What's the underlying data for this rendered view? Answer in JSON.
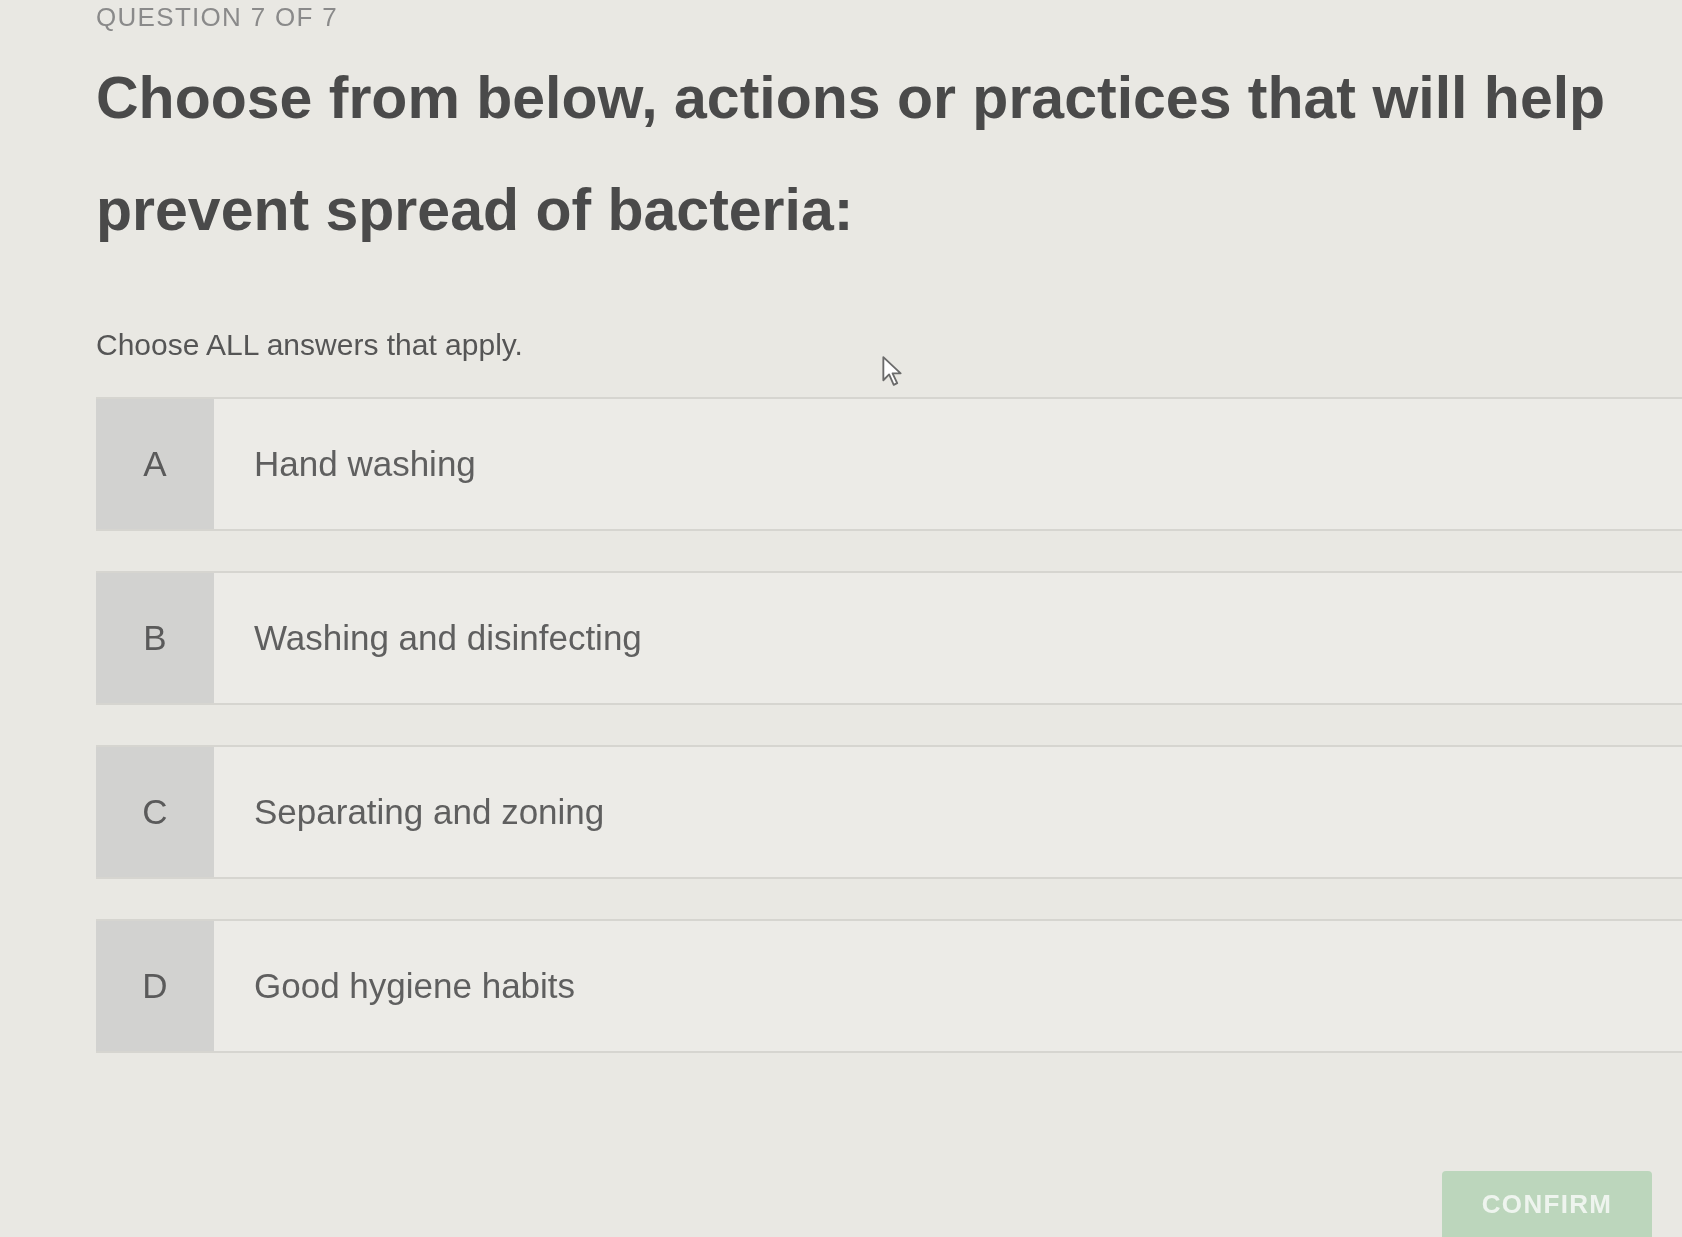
{
  "header": {
    "question_number": "QUESTION 7 OF 7"
  },
  "question": {
    "text": "Choose from below, actions or practices that will help prevent spread of bacteria:",
    "instruction": "Choose ALL answers that apply."
  },
  "options": [
    {
      "letter": "A",
      "label": "Hand washing",
      "selected": false
    },
    {
      "letter": "B",
      "label": "Washing and disinfecting",
      "selected": false
    },
    {
      "letter": "C",
      "label": "Separating and zoning",
      "selected": false
    },
    {
      "letter": "D",
      "label": "Good hygiene habits",
      "selected": false
    }
  ],
  "footer": {
    "confirm_button": "CONFIRM"
  }
}
